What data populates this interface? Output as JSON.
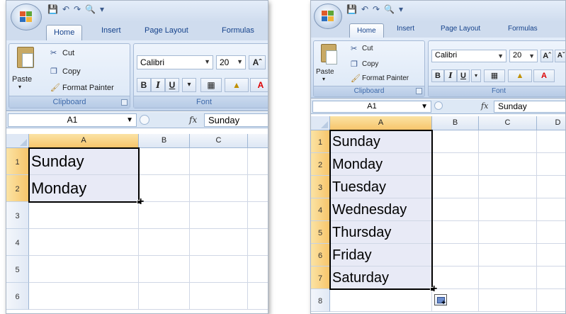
{
  "panels": [
    {
      "id": "before",
      "tabs": [
        "Home",
        "Insert",
        "Page Layout",
        "Formulas"
      ],
      "active_tab": "Home",
      "clipboard": {
        "paste": "Paste",
        "cut": "Cut",
        "copy": "Copy",
        "format_painter": "Format Painter",
        "label": "Clipboard"
      },
      "font": {
        "name": "Calibri",
        "size": "20",
        "label": "Font",
        "bold": "B",
        "italic": "I",
        "underline": "U"
      },
      "name_box": "A1",
      "fx": "fx",
      "formula": "Sunday",
      "columns": [
        "A",
        "B",
        "C"
      ],
      "rows": [
        "1",
        "2",
        "3",
        "4",
        "5",
        "6"
      ],
      "cells": [
        "Sunday",
        "Monday"
      ]
    },
    {
      "id": "after",
      "tabs": [
        "Home",
        "Insert",
        "Page Layout",
        "Formulas"
      ],
      "active_tab": "Home",
      "clipboard": {
        "paste": "Paste",
        "cut": "Cut",
        "copy": "Copy",
        "format_painter": "Format Painter",
        "label": "Clipboard"
      },
      "font": {
        "name": "Calibri",
        "size": "20",
        "label": "Font",
        "bold": "B",
        "italic": "I",
        "underline": "U"
      },
      "name_box": "A1",
      "fx": "fx",
      "formula": "Sunday",
      "columns": [
        "A",
        "B",
        "C",
        "D"
      ],
      "rows": [
        "1",
        "2",
        "3",
        "4",
        "5",
        "6",
        "7",
        "8"
      ],
      "cells": [
        "Sunday",
        "Monday",
        "Tuesday",
        "Wednesday",
        "Thursday",
        "Friday",
        "Saturday"
      ]
    }
  ],
  "colors": {
    "selection_fill": "#e8eaf6",
    "header_selected": "#f7c56b",
    "ribbon": "#d3e1f3"
  },
  "icons": [
    "office-button-icon",
    "save-icon",
    "undo-icon",
    "redo-icon",
    "print-preview-icon",
    "scissors-icon",
    "copy-icon",
    "paintbrush-icon",
    "border-icon",
    "fill-color-icon",
    "font-color-icon",
    "grow-font-icon",
    "fill-handle-cross-icon",
    "autofill-options-icon"
  ]
}
